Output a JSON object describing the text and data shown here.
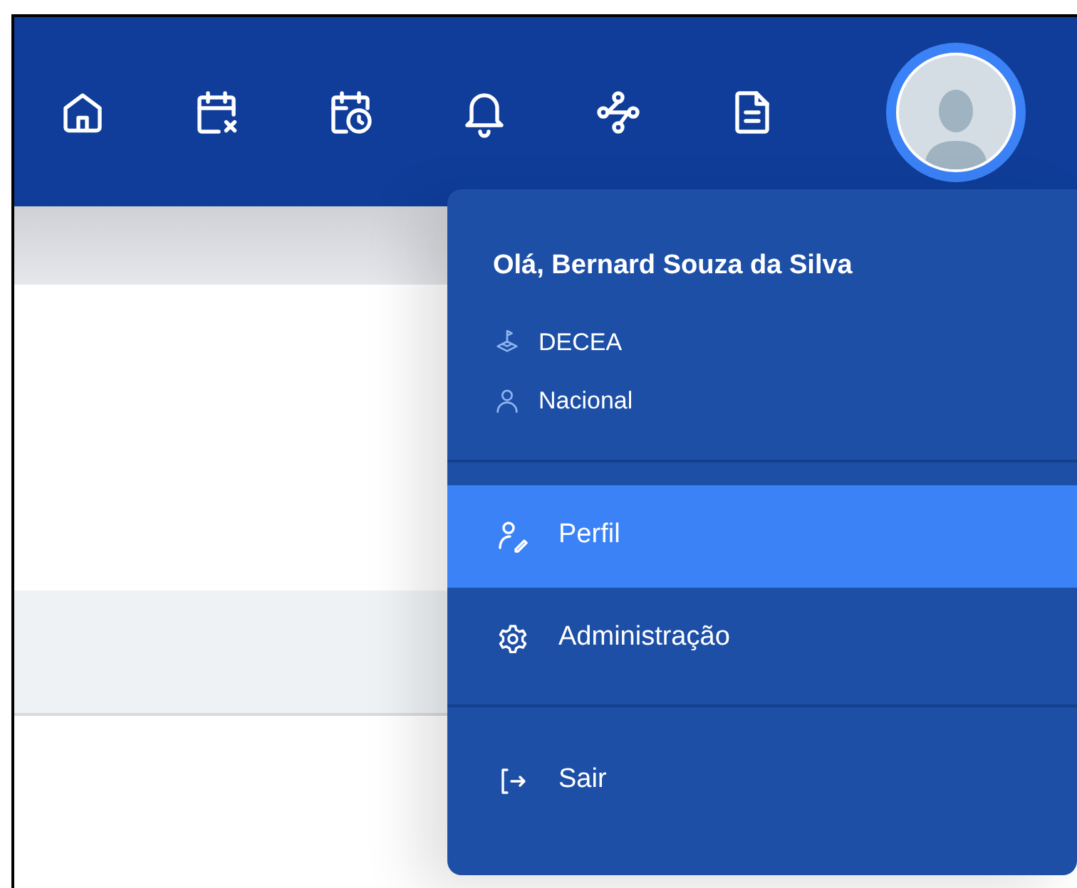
{
  "user_menu": {
    "greeting": "Olá, Bernard Souza da Silva",
    "details": [
      {
        "kind": "organization",
        "text": "DECEA"
      },
      {
        "kind": "scope",
        "text": "Nacional"
      }
    ],
    "items": [
      {
        "kind": "profile",
        "label": "Perfil",
        "selected": true
      },
      {
        "kind": "settings",
        "label": "Administração",
        "selected": false
      },
      {
        "kind": "logout",
        "label": "Sair",
        "selected": false
      }
    ]
  }
}
